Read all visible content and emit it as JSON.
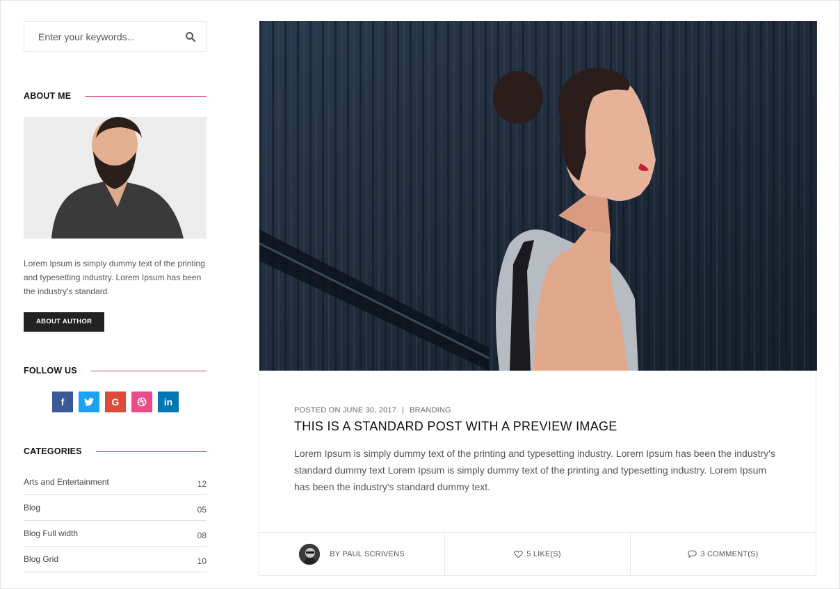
{
  "search": {
    "placeholder": "Enter your keywords..."
  },
  "about": {
    "title": "ABOUT ME",
    "text": "Lorem Ipsum is simply dummy text of the printing and typesetting industry. Lorem Ipsum has been the industry's standard.",
    "button_label": "ABOUT AUTHOR"
  },
  "follow": {
    "title": "FOLLOW US",
    "networks": [
      {
        "name": "facebook",
        "glyph": "f",
        "color": "#3b5998"
      },
      {
        "name": "twitter",
        "glyph": "t",
        "color": "#1da1f2"
      },
      {
        "name": "google-plus",
        "glyph": "G",
        "color": "#dd4b39"
      },
      {
        "name": "dribbble",
        "glyph": "◎",
        "color": "#ea4c89"
      },
      {
        "name": "linkedin",
        "glyph": "in",
        "color": "#0077b5"
      }
    ]
  },
  "categories": {
    "title": "CATEGORIES",
    "items": [
      {
        "label": "Arts and Entertainment",
        "count": "12"
      },
      {
        "label": "Blog",
        "count": "05"
      },
      {
        "label": "Blog Full width",
        "count": "08"
      },
      {
        "label": "Blog Grid",
        "count": "10"
      }
    ]
  },
  "post": {
    "date": "POSTED ON JUNE 30, 2017",
    "category": "BRANDING",
    "title": "THIS IS A STANDARD POST WITH A PREVIEW IMAGE",
    "excerpt": "Lorem Ipsum is simply dummy text of the printing and typesetting industry. Lorem Ipsum has been the industry's standard dummy text Lorem Ipsum is simply dummy text of the printing and typesetting industry. Lorem Ipsum has been the industry's standard dummy text.",
    "author": "BY PAUL SCRIVENS",
    "likes": "5 LIKE(S)",
    "comments": "3 COMMENT(S)"
  },
  "colors": {
    "accent": "#d9386b",
    "button": "#222222"
  }
}
